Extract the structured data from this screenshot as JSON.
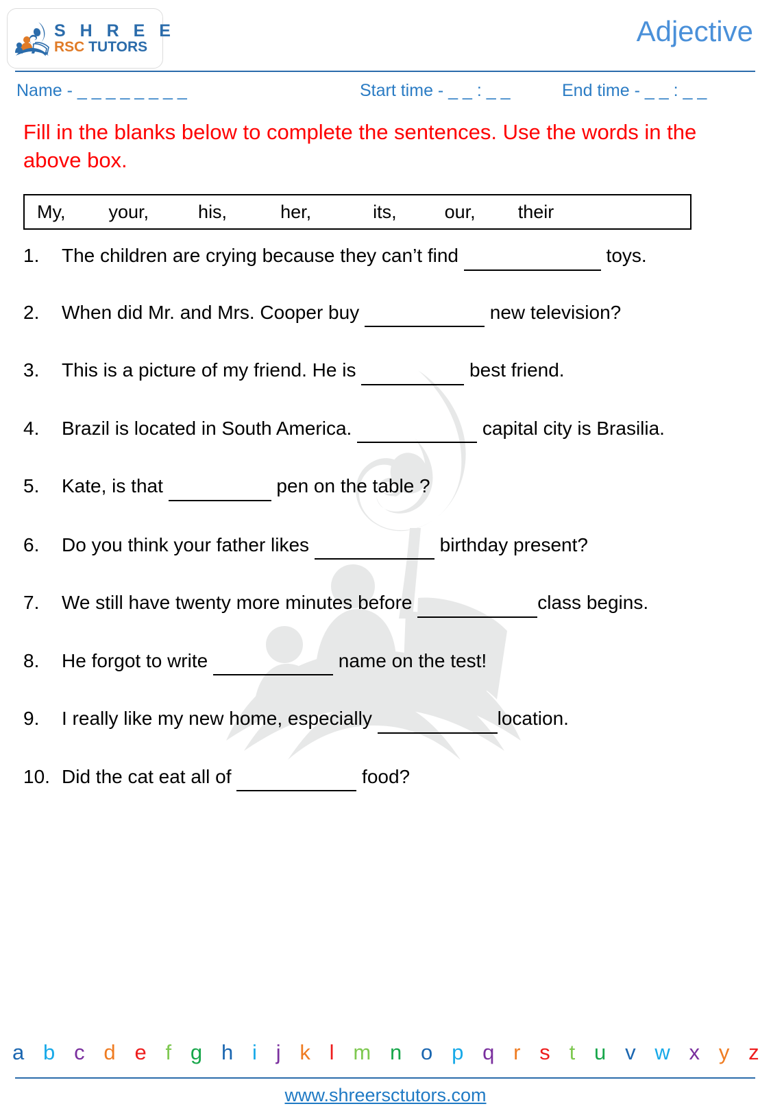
{
  "header": {
    "logo": {
      "brand_top": "S H R E E",
      "brand_bottom_orange": "RSC",
      "brand_bottom_blue": " TUTORS",
      "mark_icon": "open-book-flame-logo-icon",
      "blue": "#2b6cab",
      "orange": "#e07b27"
    },
    "title": "Adjective",
    "title_color": "#4a90d9",
    "rule_color": "#2b6cab"
  },
  "meta": {
    "name_label": "Name - _ _ _ _ _ _ _ _",
    "start_time_label": "Start time - _ _ : _ _",
    "end_time_label": "End time - _ _ : _ _",
    "color": "#2b7cc4"
  },
  "instruction": {
    "text": "Fill in the blanks below to complete the sentences. Use the words in the above box.",
    "color": "#fe0000"
  },
  "word_box": {
    "words": [
      "My,",
      "your,",
      "his,",
      "her,",
      "its,",
      "our,",
      "their"
    ]
  },
  "questions": [
    {
      "number": "1.",
      "before": "The children are crying because they can’t find ",
      "blank": "lg",
      "after": " toys."
    },
    {
      "number": "2.",
      "before": "When did Mr. and Mrs. Cooper buy ",
      "blank": "md",
      "after": " new television?"
    },
    {
      "number": "3.",
      "before": "This is a picture of my friend. He is ",
      "blank": "sm",
      "after": " best friend."
    },
    {
      "number": "4.",
      "before": "Brazil is located in South America. ",
      "blank": "md",
      "after": " capital city is Brasilia."
    },
    {
      "number": "5.",
      "before": "Kate, is that ",
      "blank": "sm",
      "after": " pen on the table ?"
    },
    {
      "number": "6.",
      "before": "Do you think your father likes ",
      "blank": "md",
      "after": " birthday present?"
    },
    {
      "number": "7.",
      "before": "We still have twenty more minutes before ",
      "blank": "md",
      "after": "class begins."
    },
    {
      "number": "8.",
      "before": "He forgot to write ",
      "blank": "md",
      "after": " name on the test!"
    },
    {
      "number": "9.",
      "before": "I really like my  new home, especially ",
      "blank": "md",
      "after": "location."
    },
    {
      "number": "10.",
      "before": "Did the cat eat all of ",
      "blank": "md",
      "after": " food?"
    }
  ],
  "alphabet": {
    "letters": [
      {
        "ch": "a",
        "color": "#1a66b0"
      },
      {
        "ch": "b",
        "color": "#17a9e8"
      },
      {
        "ch": "c",
        "color": "#7a2f9e"
      },
      {
        "ch": "d",
        "color": "#ef7c22"
      },
      {
        "ch": "e",
        "color": "#ee1c1c"
      },
      {
        "ch": "f",
        "color": "#7ec850"
      },
      {
        "ch": "g",
        "color": "#17a64a"
      },
      {
        "ch": "h",
        "color": "#1a66b0"
      },
      {
        "ch": "i",
        "color": "#17a9e8"
      },
      {
        "ch": "j",
        "color": "#7a2f9e"
      },
      {
        "ch": "k",
        "color": "#ef7c22"
      },
      {
        "ch": "l",
        "color": "#ee1c1c"
      },
      {
        "ch": "m",
        "color": "#7ec850"
      },
      {
        "ch": "n",
        "color": "#17a64a"
      },
      {
        "ch": "o",
        "color": "#1a66b0"
      },
      {
        "ch": "p",
        "color": "#17a9e8"
      },
      {
        "ch": "q",
        "color": "#7a2f9e"
      },
      {
        "ch": "r",
        "color": "#ef7c22"
      },
      {
        "ch": "s",
        "color": "#ee1c1c"
      },
      {
        "ch": "t",
        "color": "#7ec850"
      },
      {
        "ch": "u",
        "color": "#17a64a"
      },
      {
        "ch": "v",
        "color": "#1a66b0"
      },
      {
        "ch": "w",
        "color": "#17a9e8"
      },
      {
        "ch": "x",
        "color": "#7a2f9e"
      },
      {
        "ch": "y",
        "color": "#ef7c22"
      },
      {
        "ch": "z",
        "color": "#ee1c1c"
      }
    ]
  },
  "footer": {
    "url": "www.shreersctutors.com",
    "color": "#1f7ac4"
  }
}
